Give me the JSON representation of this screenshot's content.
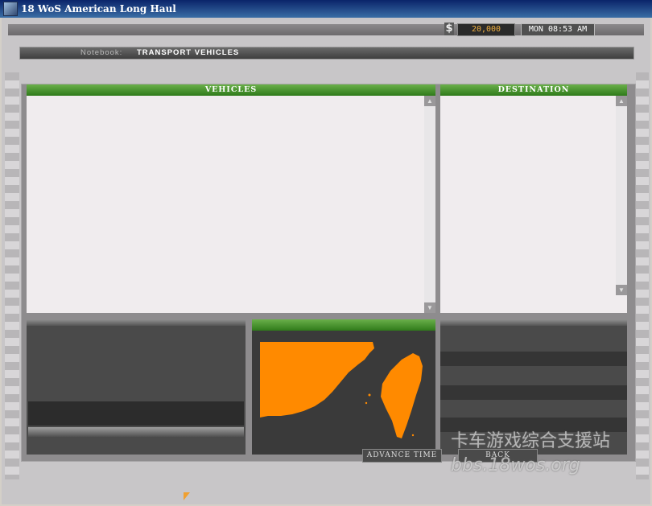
{
  "window": {
    "title": "18 WoS American Long Haul"
  },
  "status": {
    "currency_symbol": "$",
    "money": "20,000",
    "clock": "MON 08:53 AM"
  },
  "notebook": {
    "label": "Notebook:",
    "value": "TRANSPORT VEHICLES"
  },
  "panels": {
    "vehicles_header": "VEHICLES",
    "destination_header": "DESTINATION"
  },
  "buttons": {
    "advance_time": "ADVANCE TIME",
    "back": "BACK"
  },
  "watermark": {
    "line1": "卡车游戏综合支援站",
    "line2": "bbs.18wos.org"
  },
  "colors": {
    "header_green": "#3f8f24",
    "map_land": "#ff8a00",
    "map_water": "#3a3a3a",
    "money_text": "#f0b040"
  }
}
